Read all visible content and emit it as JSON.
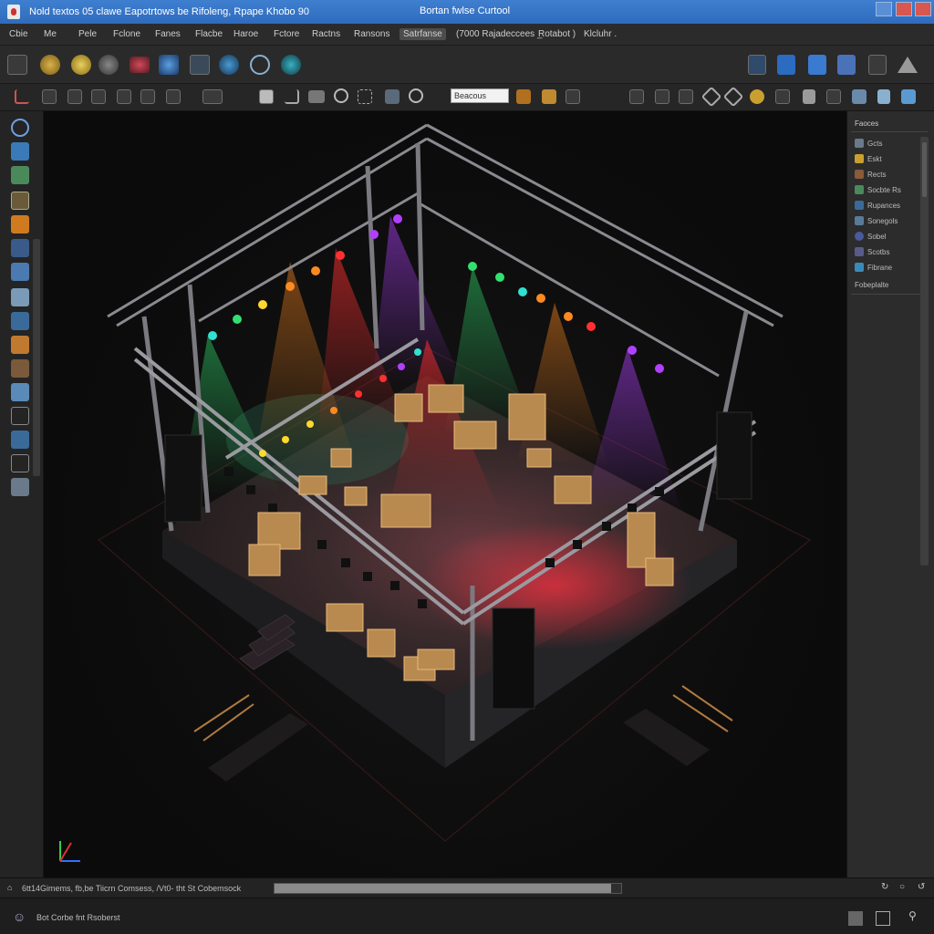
{
  "window": {
    "title": "Nold textos 05 clawe Eapotrtows be Rifoleng, Rpape Khobo 90",
    "center_title": "Bortan fwlse Curtool"
  },
  "menu": {
    "items": [
      "Cbie",
      "Me",
      "Pele",
      "Fclone",
      "Fanes",
      "Flacbe",
      "Haroe",
      "Fctore",
      "Ractns",
      "Ransons",
      "Satrfanse",
      "(7000 Rajadeccees _",
      "Rotabot )",
      "Klcluhr ."
    ]
  },
  "toolbar": {
    "search_value": "Beacous"
  },
  "panel": {
    "title": "Faoces",
    "items": [
      "Gcts",
      "Eskt",
      "Rects",
      "Socbte Rs",
      "Rupances",
      "Sonegols",
      "Sobel",
      "Scotbs",
      "Fibrane"
    ],
    "footer": "Fobeplalte"
  },
  "status": {
    "text": "6tt14Gimems, fb,be  Tiicrn Comsess,  /Vt0- tht St Cobemsock",
    "progress": 0.97
  },
  "bottom": {
    "text": "Bot Corbe fnt Rsoberst"
  },
  "colors": {
    "titlebar": "#3575c8",
    "light_red": "#ff3030",
    "light_green": "#32e070",
    "light_cyan": "#30e0d0",
    "light_purple": "#b040ff",
    "light_orange": "#ff8a20",
    "light_yellow": "#ffd830"
  }
}
